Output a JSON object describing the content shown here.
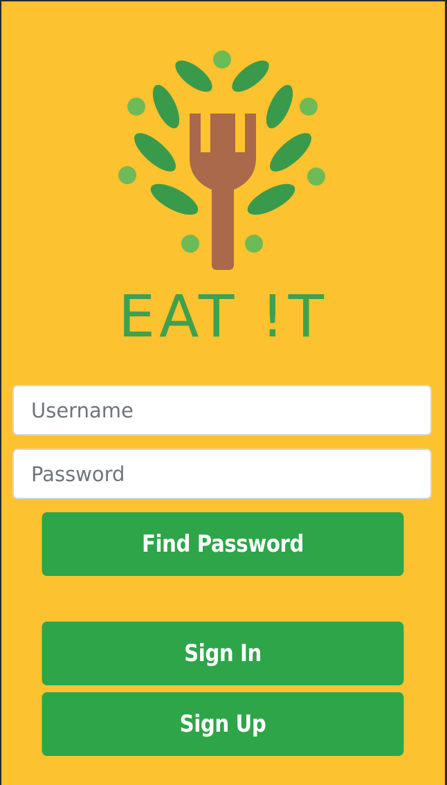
{
  "logo": {
    "icon": "fork-tree-icon",
    "text": "EAT !T",
    "colors": {
      "leaf": "#3a9a4b",
      "dot": "#6dbb57",
      "fork": "#a9694a",
      "text": "#3fa04f"
    }
  },
  "form": {
    "username_placeholder": "Username",
    "password_placeholder": "Password"
  },
  "buttons": {
    "find_password": "Find Password",
    "sign_in": "Sign In",
    "sign_up": "Sign Up"
  },
  "colors": {
    "background": "#fdc22f",
    "button": "#2ea549",
    "button_text": "#ffffff"
  }
}
